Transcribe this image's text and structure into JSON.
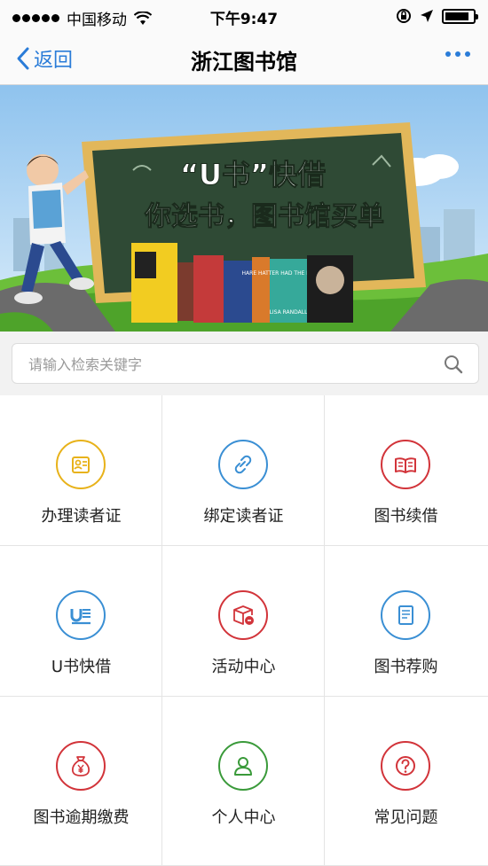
{
  "status_bar": {
    "carrier": "中国移动",
    "time": "下午9:47"
  },
  "nav": {
    "back_label": "返回",
    "title": "浙江图书馆",
    "more_icon": "more-dots-icon"
  },
  "banner": {
    "headline": "“U书”快借",
    "subline": "你选书，图书馆买单",
    "book_titles": [
      "HARE HATTER HAD THE DINOSAUR",
      "LISA RANDALL"
    ]
  },
  "search": {
    "placeholder": "请输入检索关键字",
    "icon": "search-icon"
  },
  "colors": {
    "accent": "#2a7cd8",
    "yellow": "#e8b21a",
    "blue": "#3a8fd4",
    "red": "#d2343a",
    "green": "#3a9a3a"
  },
  "menu": [
    {
      "label": "办理读者证",
      "icon": "reader-card-icon",
      "color": "#e8b21a"
    },
    {
      "label": "绑定读者证",
      "icon": "link-icon",
      "color": "#3a8fd4"
    },
    {
      "label": "图书续借",
      "icon": "open-book-icon",
      "color": "#d2343a"
    },
    {
      "label": "U书快借",
      "icon": "u-book-icon",
      "color": "#3a8fd4"
    },
    {
      "label": "活动中心",
      "icon": "activity-box-icon",
      "color": "#d2343a"
    },
    {
      "label": "图书荐购",
      "icon": "book-recommend-icon",
      "color": "#3a8fd4"
    },
    {
      "label": "图书逾期缴费",
      "icon": "money-bag-icon",
      "color": "#d2343a"
    },
    {
      "label": "个人中心",
      "icon": "person-icon",
      "color": "#3a9a3a"
    },
    {
      "label": "常见问题",
      "icon": "question-icon",
      "color": "#d2343a"
    }
  ]
}
